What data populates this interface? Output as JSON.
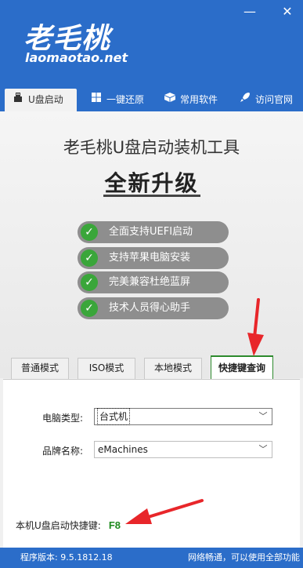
{
  "header": {
    "logo_cn": "老毛桃",
    "logo_en": "laomaotao.net",
    "minimize_glyph": "—",
    "close_glyph": "✕"
  },
  "nav": {
    "items": [
      {
        "label": "U盘启动",
        "icon": "usb-icon"
      },
      {
        "label": "一键还原",
        "icon": "windows-icon"
      },
      {
        "label": "常用软件",
        "icon": "box-icon"
      },
      {
        "label": "访问官网",
        "icon": "rocket-icon"
      }
    ]
  },
  "main": {
    "title": "老毛桃U盘启动装机工具",
    "subtitle": "全新升级",
    "features": [
      "全面支持UEFI启动",
      "支持苹果电脑安装",
      "完美兼容杜绝蓝屏",
      "技术人员得心助手"
    ]
  },
  "tabs": [
    "普通模式",
    "ISO模式",
    "本地模式",
    "快捷键查询"
  ],
  "form": {
    "computer_type_label": "电脑类型:",
    "computer_type_value": "台式机",
    "brand_label": "品牌名称:",
    "brand_value": "eMachines"
  },
  "hotkey": {
    "label": "本机U盘启动快捷键:",
    "value": "F8"
  },
  "status": {
    "version": "程序版本: 9.5.1812.18",
    "network": "网络畅通，可以使用全部功能"
  },
  "colors": {
    "brand_blue": "#2b6dc9",
    "check_green": "#3aa63a",
    "hotkey_green": "#1e8a1e",
    "arrow_red": "#e8262a"
  }
}
